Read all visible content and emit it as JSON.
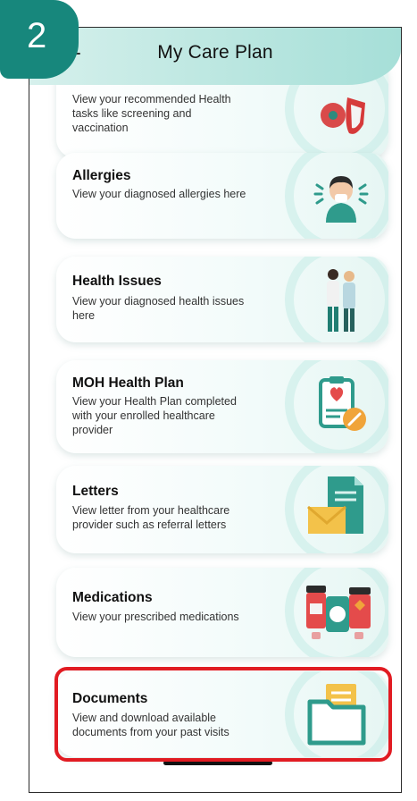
{
  "step_number": "2",
  "header": {
    "title": "My Care Plan"
  },
  "cards": [
    {
      "title": "",
      "description_lines": [
        "View your recommended Health",
        "tasks like screening and",
        "vaccination"
      ]
    },
    {
      "title": "Allergies",
      "description_lines": [
        "View your diagnosed allergies here"
      ]
    },
    {
      "title": "Health Issues",
      "description_lines": [
        "View your diagnosed health issues",
        "here"
      ]
    },
    {
      "title": "MOH Health Plan",
      "description_lines": [
        "View your Health Plan completed",
        "with your enrolled healthcare",
        "provider"
      ]
    },
    {
      "title": "Letters",
      "description_lines": [
        "View letter from your healthcare",
        "provider such as referral letters"
      ]
    },
    {
      "title": "Medications",
      "description_lines": [
        "View your prescribed medications"
      ]
    },
    {
      "title": "Documents",
      "description_lines": [
        "View and download available",
        "documents from your past visits"
      ]
    }
  ],
  "colors": {
    "accent": "#17877c",
    "highlight": "#e11b22",
    "teal_light": "#a6dfd8"
  },
  "icons": [
    "back-arrow-icon",
    "virus-shield-icon",
    "allergy-person-icon",
    "doctors-icon",
    "clipboard-heart-icon",
    "letter-envelope-icon",
    "medicine-bottles-icon",
    "folder-icon"
  ]
}
